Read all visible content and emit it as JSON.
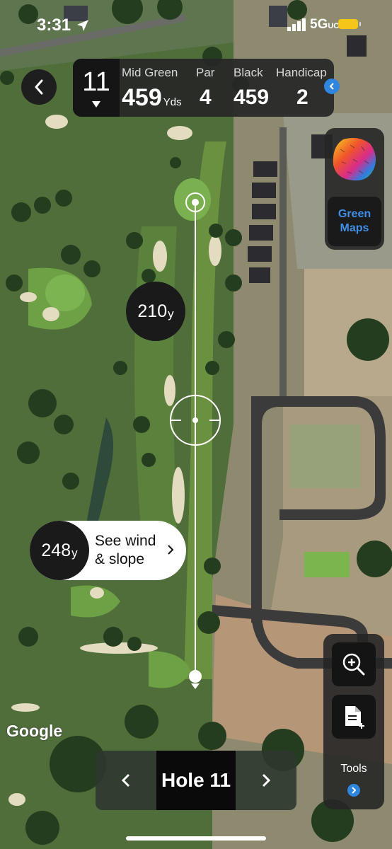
{
  "status_bar": {
    "time": "3:31",
    "network": "5G",
    "network_suffix": "UC",
    "icons": [
      "location-arrow-icon",
      "signal-icon",
      "battery-icon"
    ]
  },
  "header": {
    "hole_number": "11",
    "distance_label": "Mid Green",
    "distance_value": "459",
    "distance_unit": "Yds",
    "par_label": "Par",
    "par_value": "4",
    "tee_label": "Black",
    "tee_value": "459",
    "handicap_label": "Handicap",
    "handicap_value": "2"
  },
  "green_maps": {
    "label_line1": "Green",
    "label_line2": "Maps"
  },
  "map": {
    "target_distance": "210",
    "target_unit": "y",
    "attribution": "Google"
  },
  "wind_slope": {
    "distance": "248",
    "unit": "y",
    "line1": "See wind",
    "line2": "& slope"
  },
  "hole_nav": {
    "label": "Hole 11"
  },
  "tools": {
    "label": "Tools"
  },
  "colors": {
    "accent_blue": "#2e86de",
    "green_maps_text": "#3f8fe8",
    "panel_bg": "#262626"
  }
}
